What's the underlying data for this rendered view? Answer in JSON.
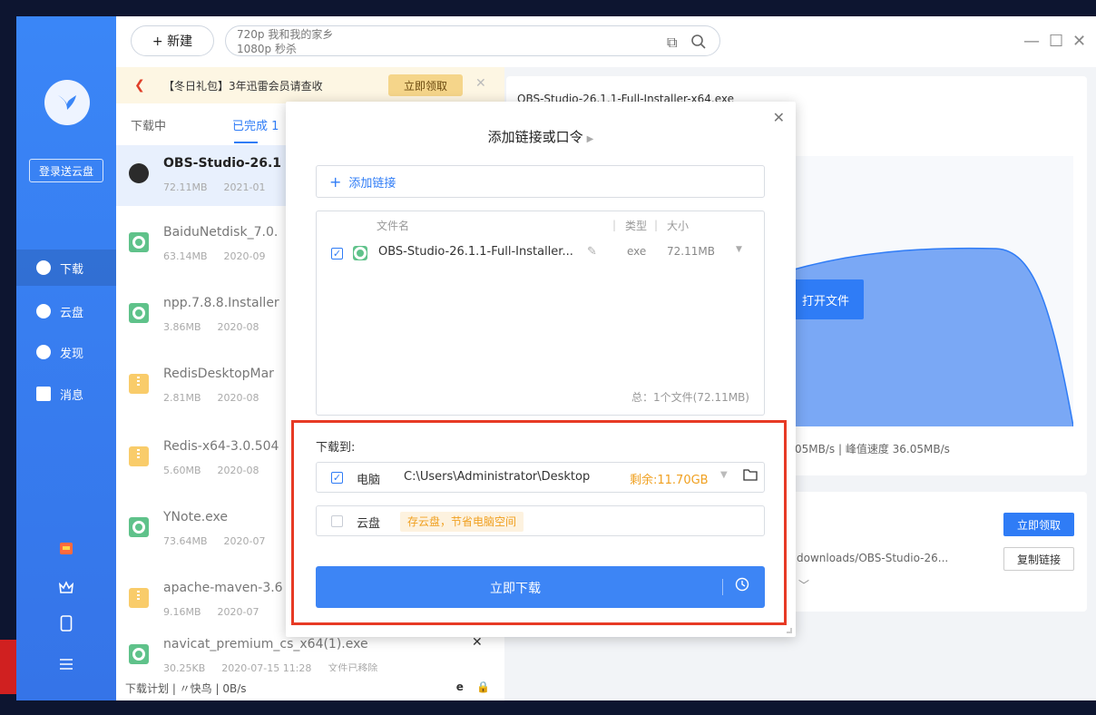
{
  "topbar": {
    "new_label": "+ 新建",
    "search_history_1": "720p 我和我的家乡",
    "search_history_2": "1080p 秒杀"
  },
  "sidebar": {
    "login_label": "登录送云盘",
    "nav": [
      {
        "label": "下载"
      },
      {
        "label": "云盘"
      },
      {
        "label": "发现"
      },
      {
        "label": "消息"
      }
    ]
  },
  "promo": {
    "text": "【冬日礼包】3年迅雷会员请查收",
    "button": "立即领取"
  },
  "tabs": {
    "downloading": "下载中",
    "completed": "已完成 1"
  },
  "files": [
    {
      "name": "OBS-Studio-26.1",
      "size": "72.11MB",
      "date": "2021-01",
      "icon": "obs"
    },
    {
      "name": "BaiduNetdisk_7.0.",
      "size": "63.14MB",
      "date": "2020-09",
      "icon": "gear"
    },
    {
      "name": "npp.7.8.8.Installer",
      "size": "3.86MB",
      "date": "2020-08",
      "icon": "gear"
    },
    {
      "name": "RedisDesktopMar",
      "size": "2.81MB",
      "date": "2020-08",
      "icon": "zip"
    },
    {
      "name": "Redis-x64-3.0.504",
      "size": "5.60MB",
      "date": "2020-08",
      "icon": "zip"
    },
    {
      "name": "YNote.exe",
      "size": "73.64MB",
      "date": "2020-07",
      "icon": "gear"
    },
    {
      "name": "apache-maven-3.6",
      "size": "9.16MB",
      "date": "2020-07",
      "icon": "zip"
    },
    {
      "name": "navicat_premium_cs_x64(1).exe",
      "size": "30.25KB",
      "date": "2020-07-15 11:28",
      "extra": "文件已移除",
      "icon": "gear"
    }
  ],
  "status_bar": {
    "text": "下载计划 | 〃快鸟 | 0B/s"
  },
  "detail": {
    "title": "OBS-Studio-26.1.1-Full-Installer-x64.exe",
    "open_label": "打开文件",
    "speed": "05MB/s | 峰值速度 36.05MB/s",
    "get_label": "立即领取",
    "path": "downloads/OBS-Studio-26...",
    "copy_label": "复制链接"
  },
  "modal": {
    "title": "添加链接或口令",
    "add_link": "添加链接",
    "col_name": "文件名",
    "col_type": "类型",
    "col_size": "大小",
    "file": {
      "name": "OBS-Studio-26.1.1-Full-Installer...",
      "type": "exe",
      "size": "72.11MB"
    },
    "total": "总：1个文件(72.11MB)",
    "download_to": "下载到:",
    "pc_label": "电脑",
    "pc_path": "C:\\Users\\Administrator\\Desktop",
    "free_space": "剩余:11.70GB",
    "cloud_label": "云盘",
    "cloud_tip": "存云盘，节省电脑空间",
    "download_btn": "立即下载"
  },
  "colors": {
    "accent": "#2f7cf6",
    "highlight": "#e73a25",
    "warn": "#f0a020"
  }
}
